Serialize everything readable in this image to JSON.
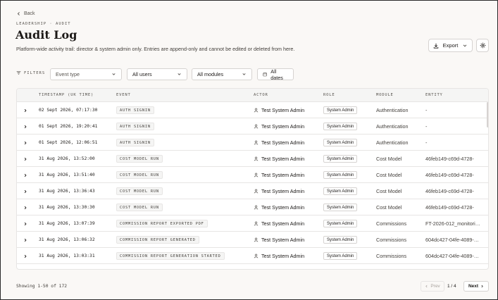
{
  "nav": {
    "back_label": "Back",
    "breadcrumb": "LEADERSHIP · AUDIT"
  },
  "header": {
    "title": "Audit Log",
    "subtitle": "Platform-wide activity trail: director & system admin only. Entries are append-only and cannot be edited or deleted from here.",
    "export_label": "Export"
  },
  "filters": {
    "label": "FILTERS",
    "event_type": "Event type",
    "users": "All users",
    "modules": "All modules",
    "dates": "All dates"
  },
  "table": {
    "columns": [
      "TIMESTAMP (UK TIME)",
      "EVENT",
      "ACTOR",
      "ROLE",
      "MODULE",
      "ENTITY"
    ],
    "rows": [
      {
        "timestamp": "02 Sept 2026, 07:17:30",
        "event": "AUTH SIGNIN",
        "actor": "Test System Admin",
        "role": "System Admin",
        "module": "Authentication",
        "entity": "-"
      },
      {
        "timestamp": "01 Sept 2026, 19:20:41",
        "event": "AUTH SIGNIN",
        "actor": "Test System Admin",
        "role": "System Admin",
        "module": "Authentication",
        "entity": "-"
      },
      {
        "timestamp": "01 Sept 2026, 12:06:51",
        "event": "AUTH SIGNIN",
        "actor": "Test System Admin",
        "role": "System Admin",
        "module": "Authentication",
        "entity": "-"
      },
      {
        "timestamp": "31 Aug 2026, 13:52:00",
        "event": "COST MODEL RUN",
        "actor": "Test System Admin",
        "role": "System Admin",
        "module": "Cost Model",
        "entity": "46feb149-c69d-4728-"
      },
      {
        "timestamp": "31 Aug 2026, 13:51:40",
        "event": "COST MODEL RUN",
        "actor": "Test System Admin",
        "role": "System Admin",
        "module": "Cost Model",
        "entity": "46feb149-c69d-4728-"
      },
      {
        "timestamp": "31 Aug 2026, 13:36:43",
        "event": "COST MODEL RUN",
        "actor": "Test System Admin",
        "role": "System Admin",
        "module": "Cost Model",
        "entity": "46feb149-c69d-4728-"
      },
      {
        "timestamp": "31 Aug 2026, 13:30:30",
        "event": "COST MODEL RUN",
        "actor": "Test System Admin",
        "role": "System Admin",
        "module": "Cost Model",
        "entity": "46feb149-c69d-4728-"
      },
      {
        "timestamp": "31 Aug 2026, 13:07:39",
        "event": "COMMISSION REPORT EXPORTED PDF",
        "actor": "Test System Admin",
        "role": "System Admin",
        "module": "Commissions",
        "entity": "FT-2026-012_monitori…"
      },
      {
        "timestamp": "31 Aug 2026, 13:06:32",
        "event": "COMMISSION REPORT GENERATED",
        "actor": "Test System Admin",
        "role": "System Admin",
        "module": "Commissions",
        "entity": "604dc427-04fe-4089-…"
      },
      {
        "timestamp": "31 Aug 2026, 13:03:31",
        "event": "COMMISSION REPORT GENERATION STARTED",
        "actor": "Test System Admin",
        "role": "System Admin",
        "module": "Commissions",
        "entity": "604dc427-04fe-4089-…"
      }
    ]
  },
  "footer": {
    "showing": "Showing 1-50 of 172",
    "prev_label": "Prev",
    "page_info": "1 / 4",
    "next_label": "Next"
  }
}
